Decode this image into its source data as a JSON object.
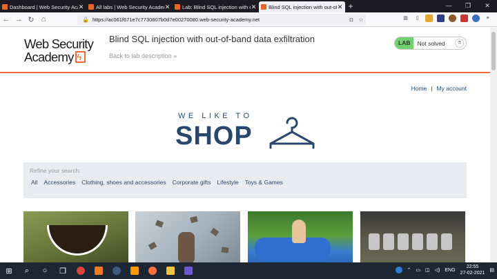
{
  "browser": {
    "tabs": [
      {
        "title": "Dashboard | Web Security Acade",
        "active": false
      },
      {
        "title": "All labs | Web Security Academ",
        "active": false
      },
      {
        "title": "Lab: Blind SQL injection with ou",
        "active": false
      },
      {
        "title": "Blind SQL injection with out-of-b",
        "active": true
      }
    ],
    "url": "https://ac061f671e7c7730807b0d7e00270080.web-security-academy.net"
  },
  "header": {
    "logo_line1": "Web Security",
    "logo_line2": "Academy",
    "lab_title": "Blind SQL injection with out-of-band data exfiltration",
    "back_link": "Back to lab description",
    "lab_badge": "LAB",
    "lab_status": "Not solved",
    "accent_color": "#ff6633"
  },
  "nav": {
    "home": "Home",
    "separator": "|",
    "account": "My account"
  },
  "shop_logo": {
    "tagline": "WE LIKE TO",
    "word": "SHOP"
  },
  "refine": {
    "label": "Refine your search:",
    "filters": [
      "All",
      "Accessories",
      "Clothing, shoes and accessories",
      "Corporate gifts",
      "Lifestyle",
      "Toys & Games"
    ]
  },
  "taskbar": {
    "language": "ENG",
    "time": "22:55",
    "date": "27-02-2021"
  }
}
